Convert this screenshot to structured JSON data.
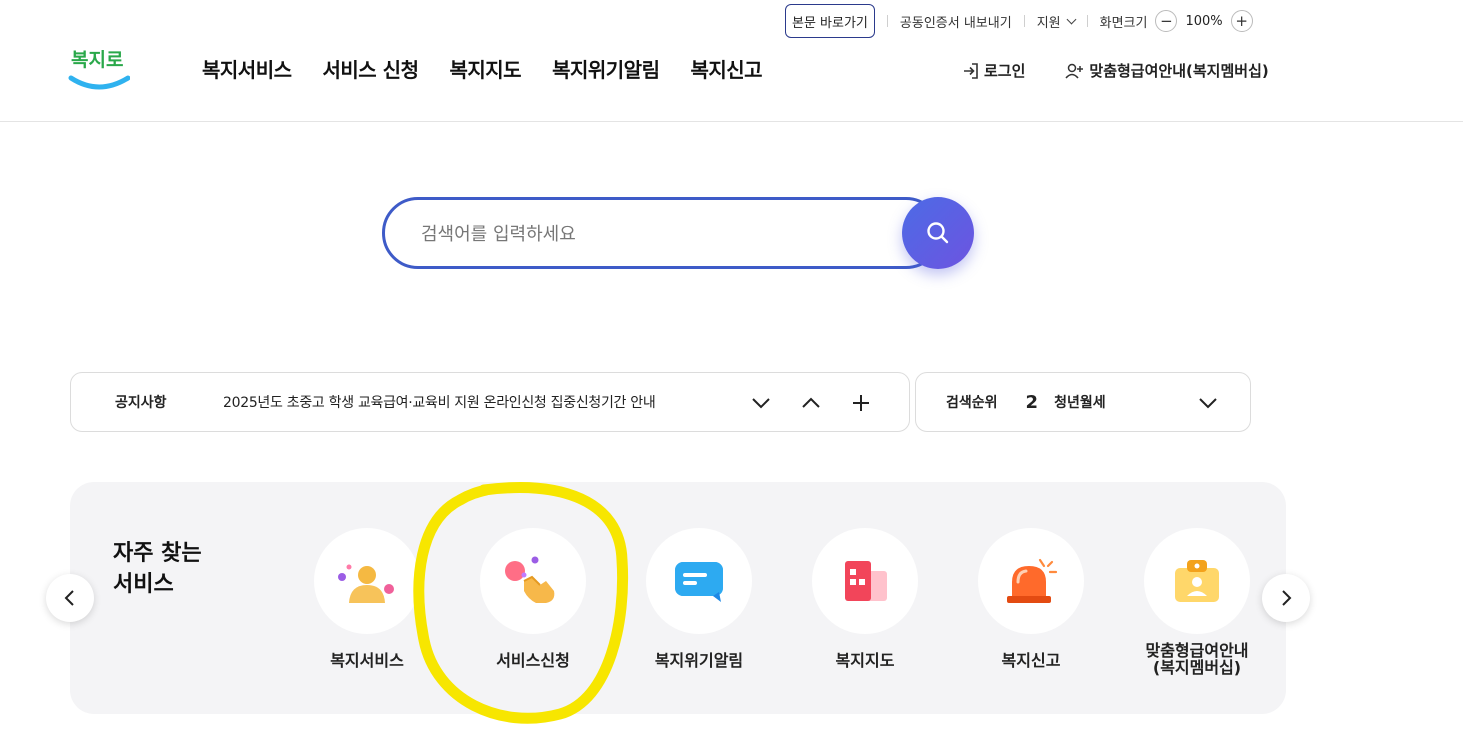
{
  "utility": {
    "skip_label": "본문 바로가기",
    "cert_label": "공동인증서 내보내기",
    "support_label": "지원",
    "zoom_label": "화면크기",
    "zoom_minus": "−",
    "zoom_value": "100%",
    "zoom_plus": "+"
  },
  "header": {
    "logo_text": "복지로",
    "nav": [
      "복지서비스",
      "서비스 신청",
      "복지지도",
      "복지위기알림",
      "복지신고"
    ],
    "login_label": "로그인",
    "member_label": "맞춤형급여안내(복지멤버십)"
  },
  "search": {
    "placeholder": "검색어를 입력하세요",
    "button_color": "#5a61e3"
  },
  "notice": {
    "title": "공지사항",
    "text": "2025년도 초중고 학생 교육급여·교육비 지원 온라인신청 집중신청기간 안내"
  },
  "rank": {
    "title": "검색순위",
    "number": "2",
    "term": "청년월세"
  },
  "quick": {
    "title_line1": "자주 찾는",
    "title_line2": "서비스",
    "items": [
      {
        "label": "복지서비스",
        "icon": "people-icon"
      },
      {
        "label": "서비스신청",
        "icon": "hand-tap-icon"
      },
      {
        "label": "복지위기알림",
        "icon": "message-icon"
      },
      {
        "label": "복지지도",
        "icon": "building-map-icon"
      },
      {
        "label": "복지신고",
        "icon": "siren-icon"
      },
      {
        "label": "맞춤형급여안내",
        "label2": "(복지멤버십)",
        "icon": "id-badge-icon"
      }
    ]
  },
  "colors": {
    "brand_blue": "#3e5bc8",
    "highlight_yellow": "#f7e600"
  }
}
